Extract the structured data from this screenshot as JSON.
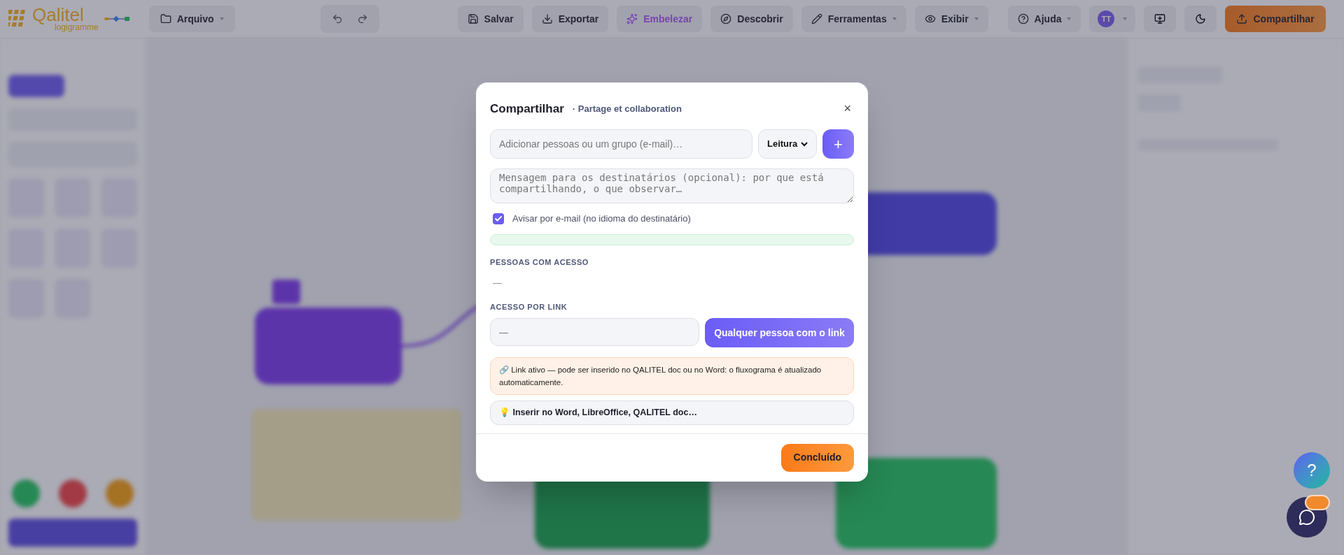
{
  "toolbar": {
    "logo": {
      "name": "Qalitel",
      "sub": "logigramme"
    },
    "menus": [
      {
        "label": "Arquivo",
        "kind": "dropdown"
      }
    ],
    "actions": [
      {
        "label": "Salvar",
        "kind": "plain"
      },
      {
        "label": "Exportar",
        "kind": "plain"
      },
      {
        "label": "Embelezar",
        "kind": "accent"
      },
      {
        "label": "Descobrir",
        "kind": "plain"
      },
      {
        "label": "Ferramentas",
        "kind": "dropdown"
      },
      {
        "label": "Exibir",
        "kind": "dropdown"
      }
    ],
    "help": {
      "label": "Ajuda",
      "kind": "dropdown"
    },
    "avatar": {
      "initials": "TT"
    },
    "share": {
      "label": "Compartilhar"
    }
  },
  "dialog": {
    "title": "Compartilhar",
    "subtitle": "· Partage et collaboration",
    "close": "×",
    "invite": {
      "placeholder": "Adicionar pessoas ou um grupo (e-mail)…",
      "role": "Leitura",
      "add": "+"
    },
    "message": {
      "placeholder": "Mensagem para os destinatários (opcional): por que está compartilhando, o que observar…"
    },
    "notify": {
      "label": "Avisar por e-mail (no idioma do destinatário)",
      "checked": true
    },
    "people": {
      "heading": "PESSOAS COM ACESSO",
      "empty": "—"
    },
    "link": {
      "heading": "ACESSO POR LINK",
      "value": "—",
      "mode": "Qualquer pessoa com o link"
    },
    "notice": "🔗 Link ativo — pode ser inserido no QALITEL doc ou no Word: o fluxograma é atualizado automaticamente.",
    "tip": "💡 Inserir no Word, LibreOffice, QALITEL doc…",
    "done": "Concluído"
  },
  "help_fab": {
    "label": "?"
  }
}
